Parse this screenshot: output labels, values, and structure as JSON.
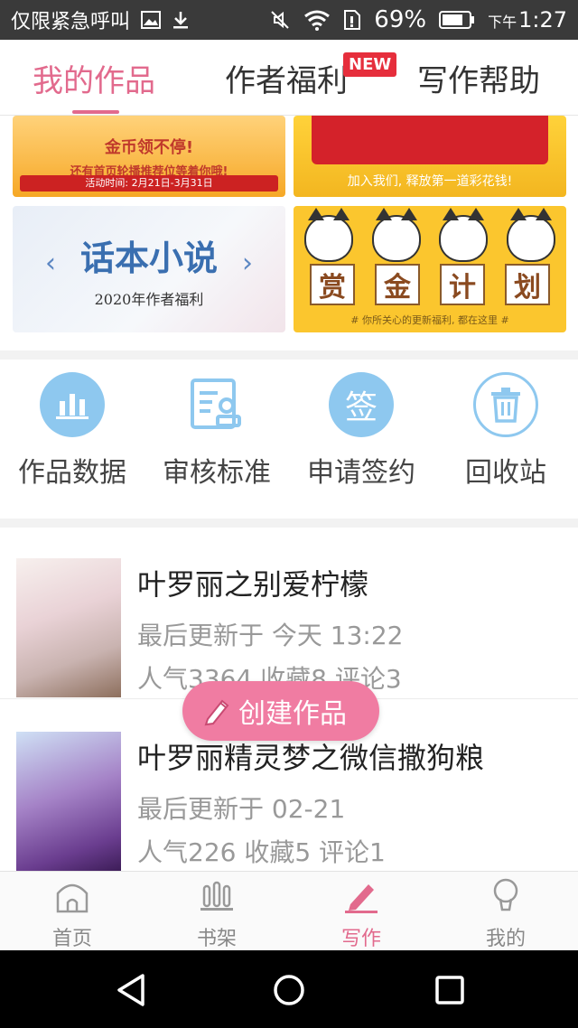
{
  "status_bar": {
    "app_label": "仅限紧急呼叫",
    "battery": "69%",
    "time_prefix": "下午",
    "time": "1:27"
  },
  "top_tabs": [
    {
      "label": "我的作品",
      "active": true
    },
    {
      "label": "作者福利",
      "badge": "NEW"
    },
    {
      "label": "写作帮助"
    }
  ],
  "banners": {
    "gold": {
      "headline": "金币领不停!",
      "line": "还有首页轮播推荐位等着你哦!",
      "date": "活动时间: 2月21日-3月31日"
    },
    "net": {
      "caption": "加入我们, 释放第一道彩花钱!"
    },
    "novel": {
      "title": "话本小说",
      "subtitle": "2020年作者福利"
    },
    "bounty": {
      "cards": [
        "赏",
        "金",
        "计",
        "划"
      ],
      "footer": "# 你所关心的更新福利, 都在这里 #"
    }
  },
  "tools": [
    {
      "label": "作品数据",
      "icon": "bar-chart-icon",
      "color": "#8ec8ef"
    },
    {
      "label": "审核标准",
      "icon": "review-doc-icon",
      "color": "#8ec8ef"
    },
    {
      "label": "申请签约",
      "icon": "sign-icon",
      "color": "#8ec8ef",
      "glyph": "签"
    },
    {
      "label": "回收站",
      "icon": "trash-icon",
      "color": "#8ec8ef"
    }
  ],
  "works": [
    {
      "title": "叶罗丽之别爱柠檬",
      "updated": "最后更新于 今天 13:22",
      "stats": "人气3364 收藏8 评论3"
    },
    {
      "title": "叶罗丽精灵梦之微信撒狗粮",
      "updated": "最后更新于 02-21",
      "stats": "人气226 收藏5 评论1"
    }
  ],
  "fab": {
    "label": "创建作品",
    "color": "#f07ca2"
  },
  "bottom_nav": [
    {
      "label": "首页",
      "icon": "home-icon"
    },
    {
      "label": "书架",
      "icon": "bookshelf-icon"
    },
    {
      "label": "写作",
      "icon": "pen-icon",
      "active": true
    },
    {
      "label": "我的",
      "icon": "profile-icon"
    }
  ],
  "accent": "#e26a8d"
}
